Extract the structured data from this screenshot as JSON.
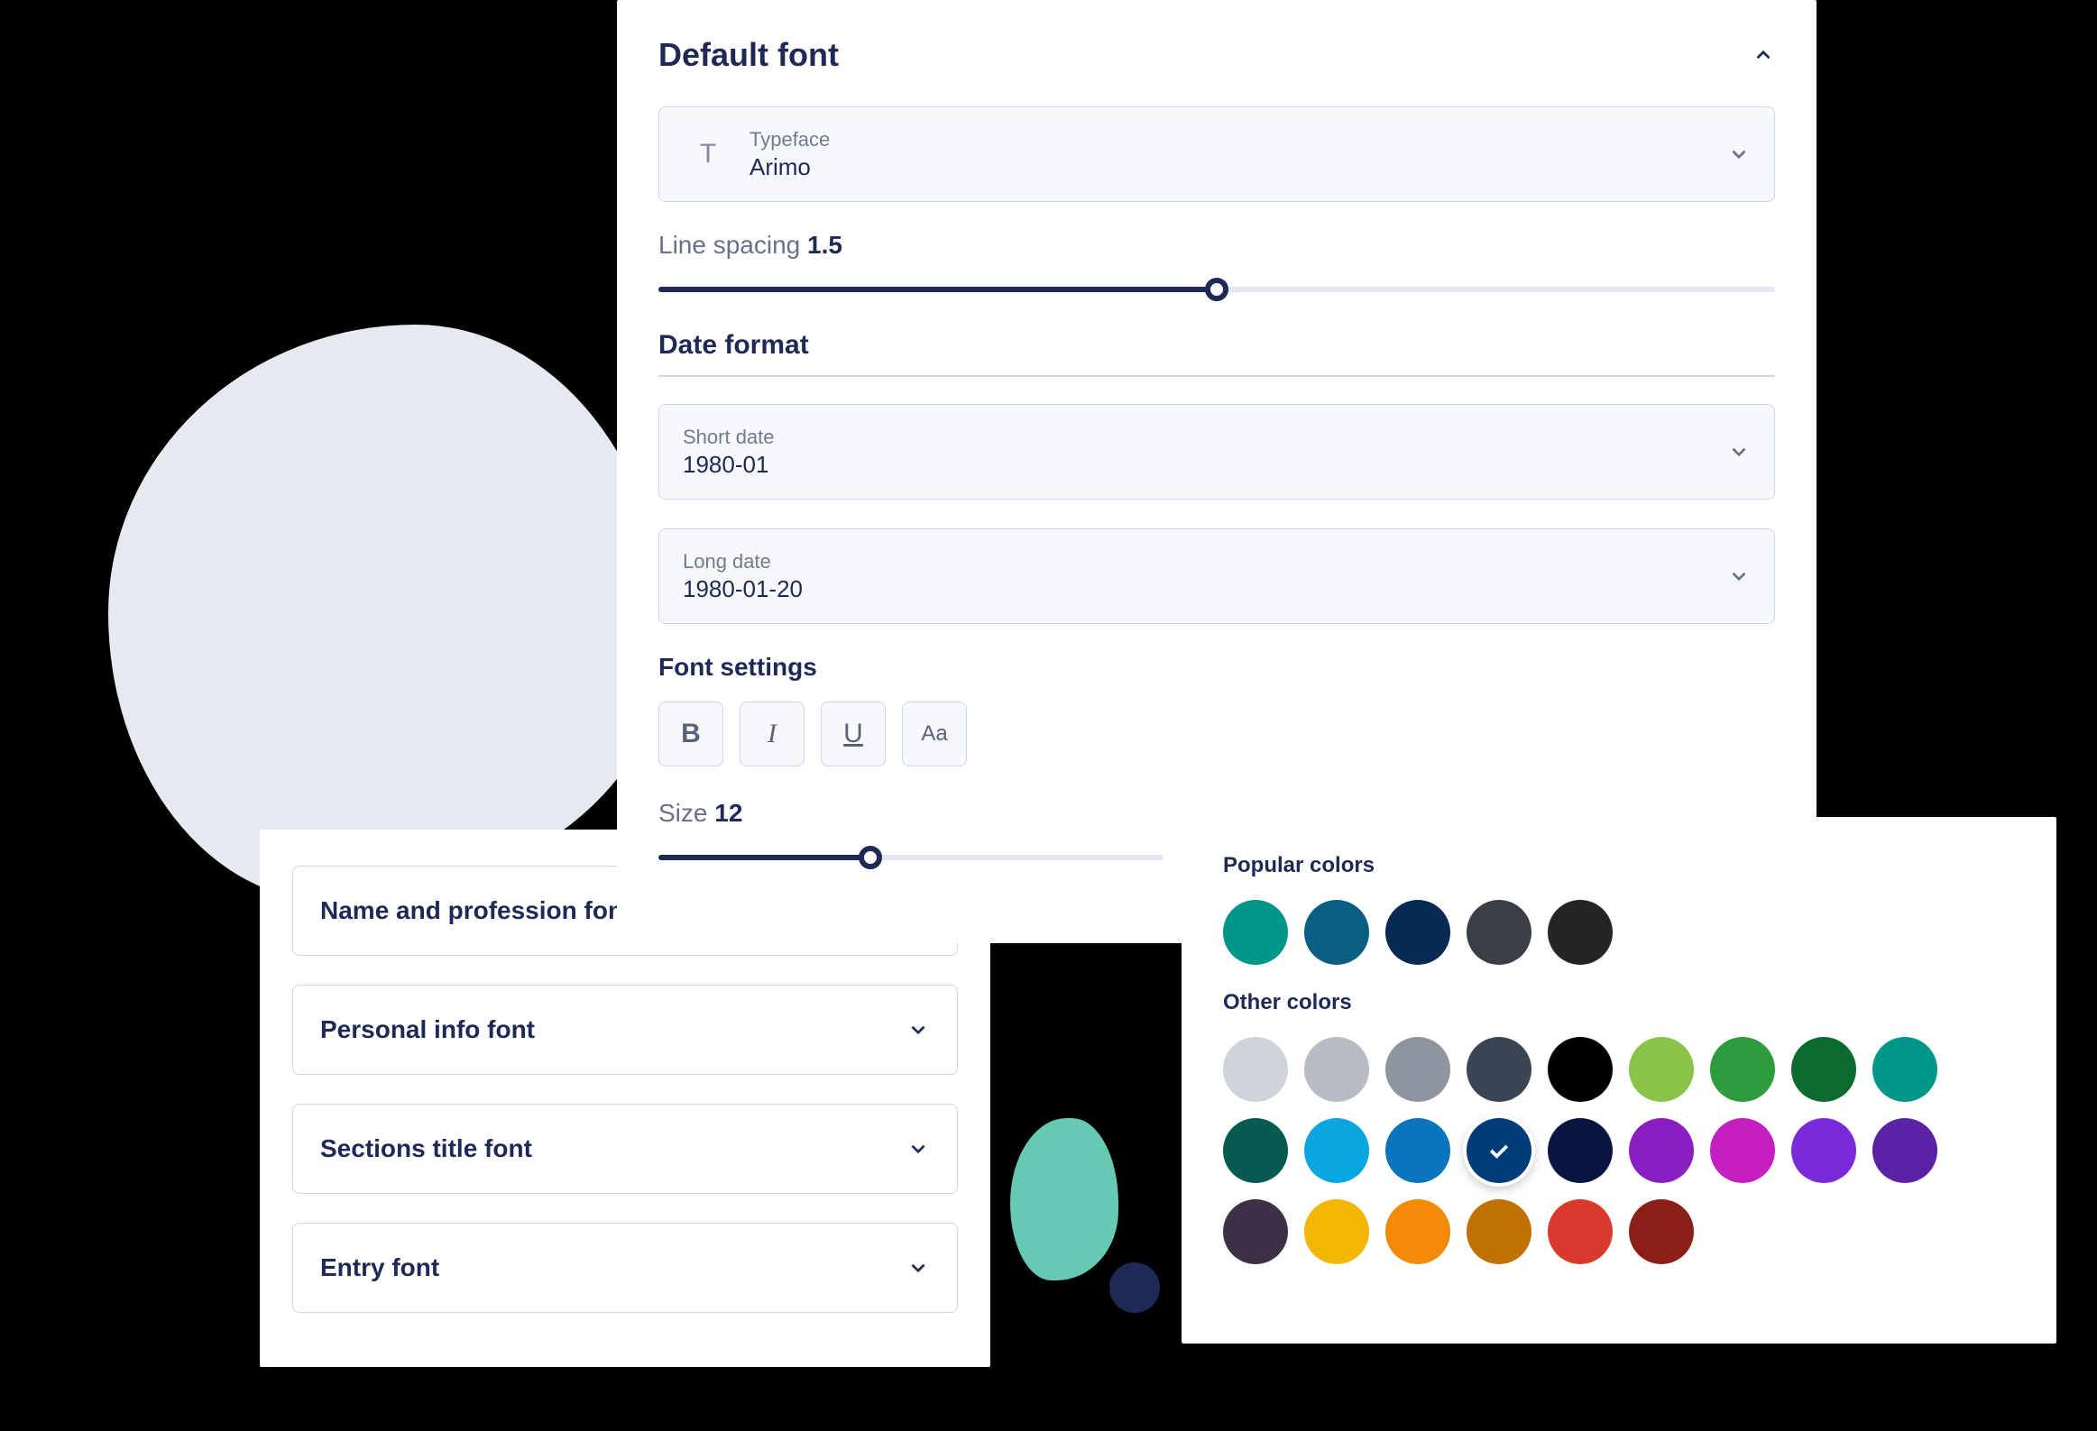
{
  "left_accordion": {
    "items": [
      {
        "label": "Name and profession font"
      },
      {
        "label": "Personal info font"
      },
      {
        "label": "Sections title font"
      },
      {
        "label": "Entry font"
      }
    ]
  },
  "main": {
    "title": "Default font",
    "typeface": {
      "label": "Typeface",
      "value": "Arimo"
    },
    "line_spacing": {
      "label": "Line spacing",
      "value": "1.5",
      "pct": 50
    },
    "date_format_title": "Date format",
    "short_date": {
      "label": "Short date",
      "value": "1980-01"
    },
    "long_date": {
      "label": "Long date",
      "value": "1980-01-20"
    },
    "font_settings_title": "Font settings",
    "size": {
      "label": "Size",
      "value": "12",
      "pct": 42
    }
  },
  "colors": {
    "popular_title": "Popular colors",
    "other_title": "Other colors",
    "popular": [
      "#009688",
      "#0b5d82",
      "#062a54",
      "#3a3f47",
      "#232527"
    ],
    "other": [
      "#cfd3da",
      "#b6bbc4",
      "#8e959f",
      "#3c4554",
      "#000000",
      "#8bc34a",
      "#2e9b3c",
      "#0b6b2e",
      "#009688",
      "#065a4f",
      "#0aa6e0",
      "#0a74bf",
      "#003c78",
      "#0a1440",
      "#8a1fc1",
      "#c61fc1",
      "#7a2bd9",
      "#5a23a5",
      "#3d3148",
      "#f2b705",
      "#f28a05",
      "#bf7104",
      "#d93a2b",
      "#8a1f17"
    ],
    "selected": "#003c78"
  }
}
